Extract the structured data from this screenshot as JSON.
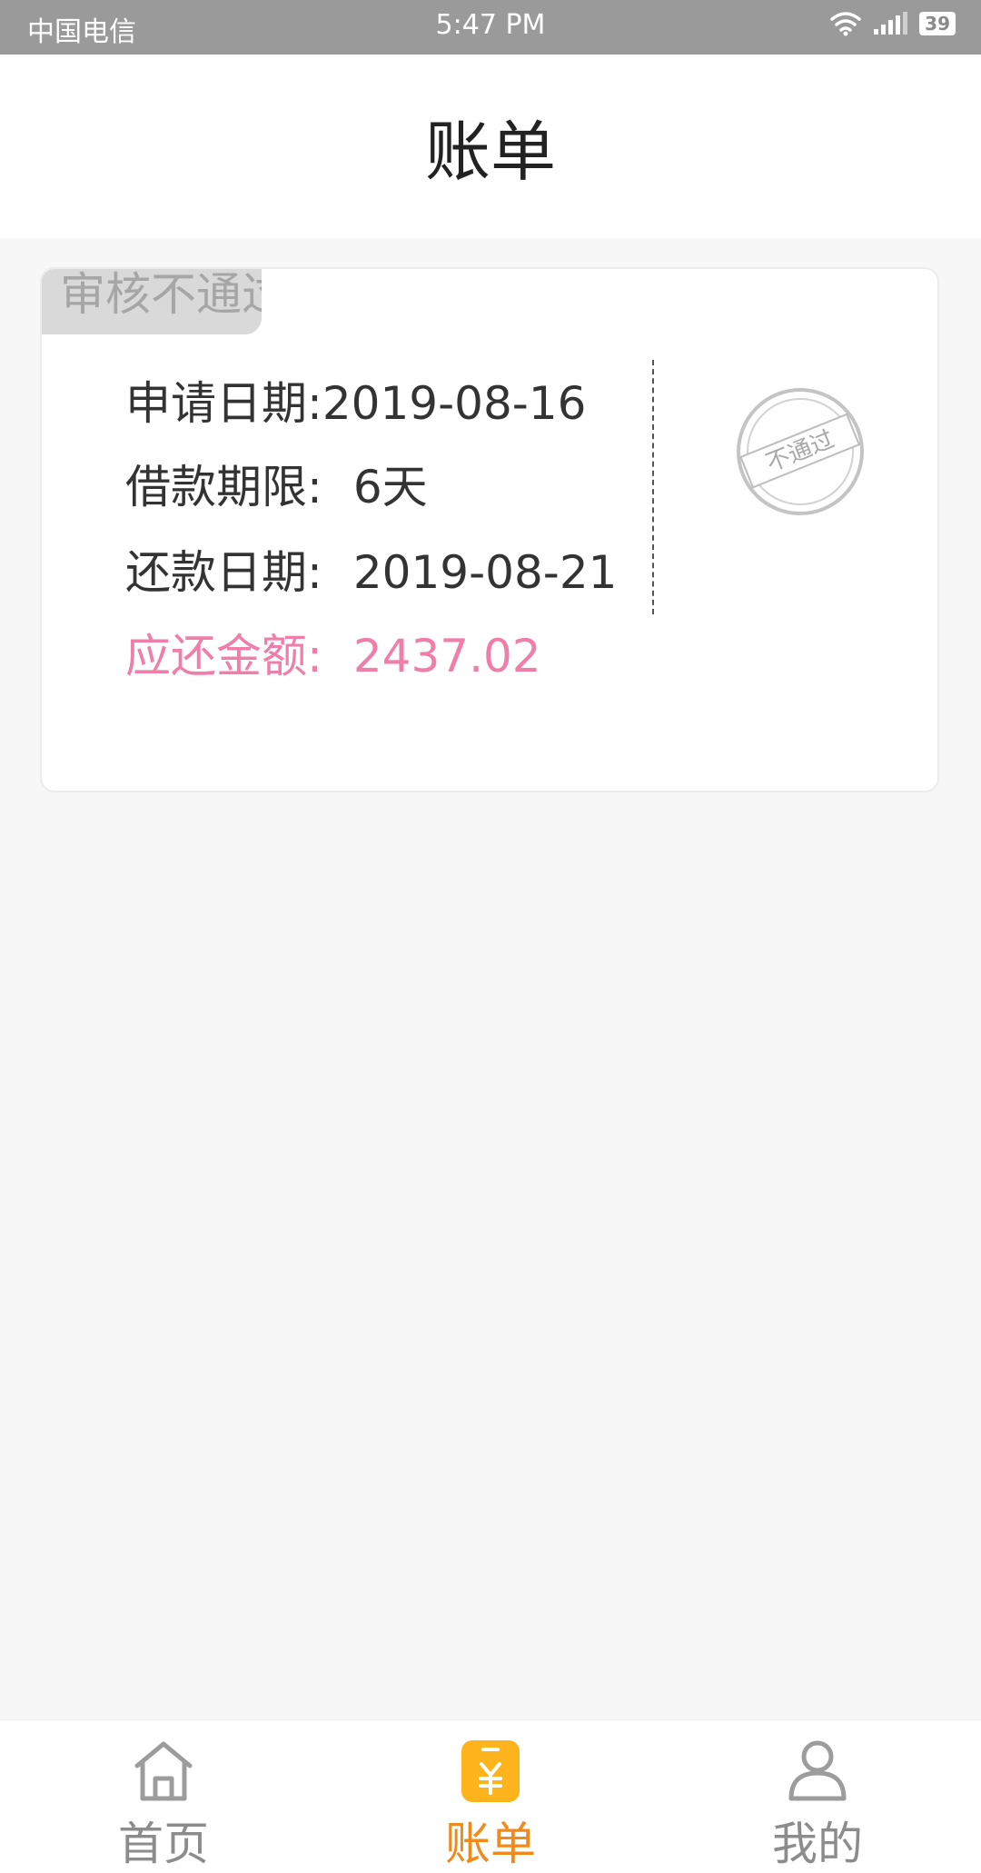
{
  "status_bar": {
    "carrier": "中国电信",
    "time": "5:47 PM",
    "battery": "39"
  },
  "header": {
    "title": "账单"
  },
  "bill_card": {
    "status_tag": "审核不通过",
    "apply_date_label": "申请日期:",
    "apply_date_value": "2019-08-16",
    "term_label": "借款期限:",
    "term_value": "6天",
    "repay_date_label": "还款日期:",
    "repay_date_value": "2019-08-21",
    "amount_label": "应还金额:",
    "amount_value": "2437.02",
    "stamp_text": "不通过"
  },
  "bottom_nav": {
    "items": [
      {
        "label": "首页",
        "icon": "home-icon",
        "active": false
      },
      {
        "label": "账单",
        "icon": "bill-icon",
        "active": true
      },
      {
        "label": "我的",
        "icon": "user-icon",
        "active": false
      }
    ]
  },
  "colors": {
    "accent": "#f08a1a",
    "amount": "#ef7ea9",
    "bill_icon": "#ffb41e",
    "status_bar": "#9a9a9a"
  }
}
